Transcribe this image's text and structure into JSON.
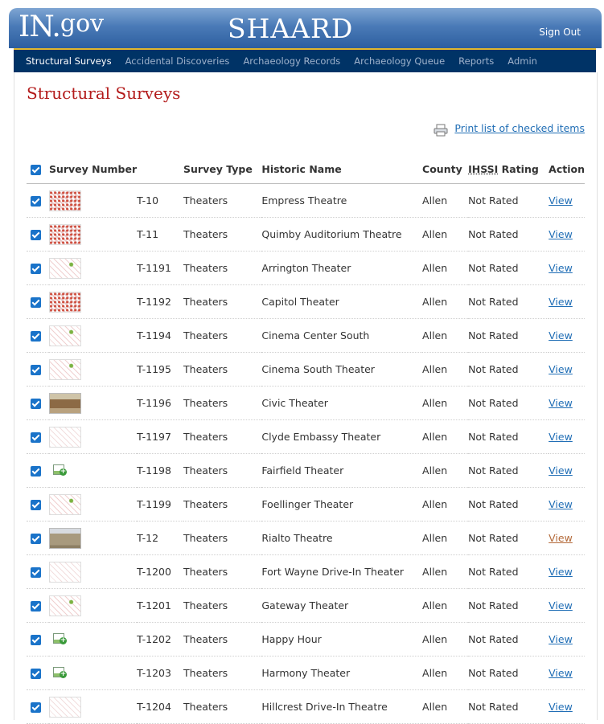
{
  "header": {
    "logo_main": "IN.",
    "logo_small": "gov",
    "app_title": "SHAARD",
    "signout_label": "Sign Out"
  },
  "nav": {
    "items": [
      {
        "label": "Structural Surveys",
        "active": true
      },
      {
        "label": "Accidental Discoveries",
        "active": false
      },
      {
        "label": "Archaeology Records",
        "active": false
      },
      {
        "label": "Archaeology Queue",
        "active": false
      },
      {
        "label": "Reports",
        "active": false
      },
      {
        "label": "Admin",
        "active": false
      }
    ]
  },
  "page": {
    "title": "Structural Surveys",
    "print_label": "Print list of checked items",
    "print_icon": "printer-icon"
  },
  "table": {
    "headers": {
      "survey_number": "Survey Number",
      "survey_type": "Survey Type",
      "historic_name": "Historic Name",
      "county": "County",
      "rating_abbr": "IHSSI",
      "rating_rest": " Rating",
      "action": "Action"
    },
    "rows": [
      {
        "thumb": "pattern",
        "number": "T-10",
        "type": "Theaters",
        "name": "Empress Theatre",
        "county": "Allen",
        "rating": "Not Rated",
        "action": "View",
        "checked": true
      },
      {
        "thumb": "pattern",
        "number": "T-11",
        "type": "Theaters",
        "name": "Quimby Auditorium Theatre",
        "county": "Allen",
        "rating": "Not Rated",
        "action": "View",
        "checked": true
      },
      {
        "thumb": "green",
        "number": "T-1191",
        "type": "Theaters",
        "name": "Arrington Theater",
        "county": "Allen",
        "rating": "Not Rated",
        "action": "View",
        "checked": true
      },
      {
        "thumb": "pattern",
        "number": "T-1192",
        "type": "Theaters",
        "name": "Capitol Theater",
        "county": "Allen",
        "rating": "Not Rated",
        "action": "View",
        "checked": true
      },
      {
        "thumb": "green",
        "number": "T-1194",
        "type": "Theaters",
        "name": "Cinema Center South",
        "county": "Allen",
        "rating": "Not Rated",
        "action": "View",
        "checked": true
      },
      {
        "thumb": "green",
        "number": "T-1195",
        "type": "Theaters",
        "name": "Cinema South Theater",
        "county": "Allen",
        "rating": "Not Rated",
        "action": "View",
        "checked": true
      },
      {
        "thumb": "photo",
        "number": "T-1196",
        "type": "Theaters",
        "name": "Civic Theater",
        "county": "Allen",
        "rating": "Not Rated",
        "action": "View",
        "checked": true
      },
      {
        "thumb": "light",
        "number": "T-1197",
        "type": "Theaters",
        "name": "Clyde Embassy Theater",
        "county": "Allen",
        "rating": "Not Rated",
        "action": "View",
        "checked": true
      },
      {
        "thumb": "none",
        "number": "T-1198",
        "type": "Theaters",
        "name": "Fairfield Theater",
        "county": "Allen",
        "rating": "Not Rated",
        "action": "View",
        "checked": true
      },
      {
        "thumb": "green",
        "number": "T-1199",
        "type": "Theaters",
        "name": "Foellinger Theater",
        "county": "Allen",
        "rating": "Not Rated",
        "action": "View",
        "checked": true
      },
      {
        "thumb": "photo2",
        "number": "T-12",
        "type": "Theaters",
        "name": "Rialto Theatre",
        "county": "Allen",
        "rating": "Not Rated",
        "action": "View",
        "checked": true,
        "visited": true
      },
      {
        "thumb": "light",
        "number": "T-1200",
        "type": "Theaters",
        "name": "Fort Wayne Drive-In Theater",
        "county": "Allen",
        "rating": "Not Rated",
        "action": "View",
        "checked": true
      },
      {
        "thumb": "green",
        "number": "T-1201",
        "type": "Theaters",
        "name": "Gateway Theater",
        "county": "Allen",
        "rating": "Not Rated",
        "action": "View",
        "checked": true
      },
      {
        "thumb": "none",
        "number": "T-1202",
        "type": "Theaters",
        "name": "Happy Hour",
        "county": "Allen",
        "rating": "Not Rated",
        "action": "View",
        "checked": true
      },
      {
        "thumb": "none",
        "number": "T-1203",
        "type": "Theaters",
        "name": "Harmony Theater",
        "county": "Allen",
        "rating": "Not Rated",
        "action": "View",
        "checked": true
      },
      {
        "thumb": "light",
        "number": "T-1204",
        "type": "Theaters",
        "name": "Hillcrest Drive-In Theatre",
        "county": "Allen",
        "rating": "Not Rated",
        "action": "View",
        "checked": true
      }
    ]
  },
  "colors": {
    "title_red": "#b31b1b",
    "nav_bg": "#003366",
    "nav_accent": "#e3b72e",
    "link_blue": "#1f6db5",
    "checkbox_blue": "#1a73c9"
  }
}
